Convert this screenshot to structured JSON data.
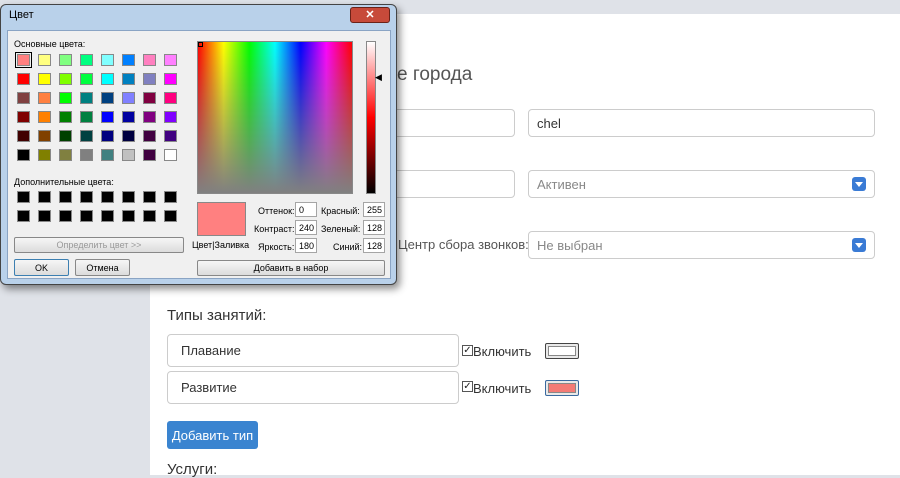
{
  "page": {
    "heading_partial": "е города",
    "code_value": "chel",
    "status_value": "Активен",
    "call_center_label": "Центр сбора звонков:",
    "call_center_value": "Не выбран",
    "types_heading": "Типы занятий:",
    "types": [
      {
        "name": "Плавание",
        "include_label": "Включить",
        "checked": true,
        "color": "#ffffff"
      },
      {
        "name": "Развитие",
        "include_label": "Включить",
        "checked": true,
        "color": "#f47b76"
      }
    ],
    "add_type_label": "Добавить тип",
    "services_heading": "Услуги:"
  },
  "dialog": {
    "title": "Цвет",
    "close_glyph": "✕",
    "basic_colors_label": "Основные цвета:",
    "basic_colors": [
      "#ff8080",
      "#ffff80",
      "#80ff80",
      "#00ff80",
      "#80ffff",
      "#0080ff",
      "#ff80c0",
      "#ff80ff",
      "#ff0000",
      "#ffff00",
      "#80ff00",
      "#00ff40",
      "#00ffff",
      "#0080c0",
      "#8080c0",
      "#ff00ff",
      "#804040",
      "#ff8040",
      "#00ff00",
      "#008080",
      "#004080",
      "#8080ff",
      "#800040",
      "#ff0080",
      "#800000",
      "#ff8000",
      "#008000",
      "#008040",
      "#0000ff",
      "#0000a0",
      "#800080",
      "#8000ff",
      "#400000",
      "#804000",
      "#004000",
      "#004040",
      "#000080",
      "#000040",
      "#400040",
      "#400080",
      "#000000",
      "#808000",
      "#808040",
      "#808080",
      "#408080",
      "#c0c0c0",
      "#400040",
      "#ffffff"
    ],
    "selected_index": 0,
    "custom_colors_label": "Дополнительные цвета:",
    "custom_colors": [
      "#000000",
      "#000000",
      "#000000",
      "#000000",
      "#000000",
      "#000000",
      "#000000",
      "#000000",
      "#000000",
      "#000000",
      "#000000",
      "#000000",
      "#000000",
      "#000000",
      "#000000",
      "#000000"
    ],
    "define_custom_label": "Определить цвет >>",
    "ok_label": "OK",
    "cancel_label": "Отмена",
    "preview_color": "#ff8080",
    "color_solid_label": "Цвет|Заливка",
    "hue_label": "Оттенок:",
    "hue_value": "0",
    "sat_label": "Контраст:",
    "sat_value": "240",
    "lum_label": "Яркость:",
    "lum_value": "180",
    "red_label": "Красный:",
    "red_value": "255",
    "green_label": "Зеленый:",
    "green_value": "128",
    "blue_label": "Синий:",
    "blue_value": "128",
    "add_custom_label": "Добавить в набор",
    "slider_arrow": "◀"
  }
}
